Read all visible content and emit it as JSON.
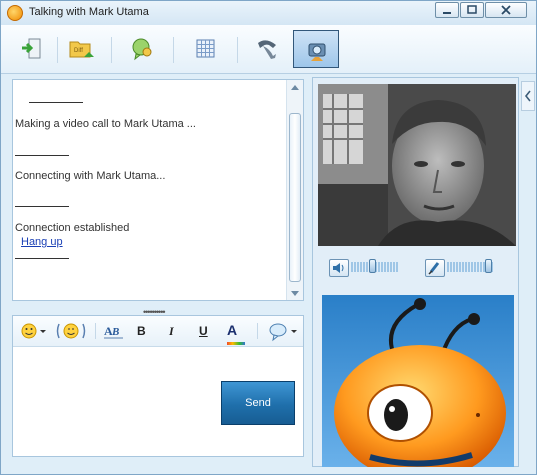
{
  "window": {
    "title": "Talking with Mark Utama"
  },
  "title_buttons": [
    {
      "name": "minimize-button",
      "icon": "minimize-icon"
    },
    {
      "name": "maximize-button",
      "icon": "maximize-icon"
    },
    {
      "name": "close-button",
      "icon": "close-icon"
    }
  ],
  "toolbar": [
    {
      "name": "send-file-button",
      "icon": "send-file-icon"
    },
    {
      "name": "diff-file-button",
      "icon": "diff-file-icon"
    },
    {
      "name": "add-contact-button",
      "icon": "add-contact-icon"
    },
    {
      "name": "whiteboard-button",
      "icon": "grid-icon"
    },
    {
      "name": "voice-call-button",
      "icon": "phone-icon"
    },
    {
      "name": "video-call-button",
      "icon": "video-call-icon",
      "active": true
    }
  ],
  "chat": {
    "messages": [
      {
        "text": "Making a video call to Mark Utama ..."
      },
      {
        "text": "Connecting with Mark Utama..."
      },
      {
        "text": "Connection established"
      }
    ],
    "hangup_link": "Hang up"
  },
  "splitter": "••••••••••",
  "compose": {
    "format_buttons": {
      "bold": "B",
      "italic": "I",
      "underline": "U",
      "font_color": "A"
    },
    "send_label": "Send"
  },
  "colors": {
    "accent": "#1f6fab",
    "link": "#1a3fb5",
    "panel": "#dfeef8",
    "border": "#a8c6de"
  }
}
